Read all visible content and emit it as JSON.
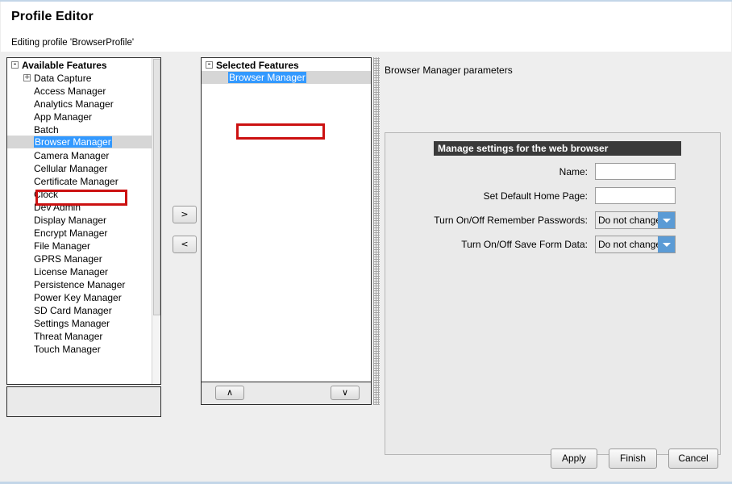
{
  "window": {
    "title": "Profile Editor",
    "subtitle": "Editing profile 'BrowserProfile'",
    "accent_blue": "#3399ff",
    "annotation_color": "#cc1111",
    "combo_button_color": "#5b9bd5",
    "banner_color": "#3a3a3a"
  },
  "available": {
    "root_label": "Available Features",
    "root_expander": "-",
    "group": {
      "label": "Data Capture",
      "expander": "+"
    },
    "items": [
      "Access Manager",
      "Analytics Manager",
      "App Manager",
      "Batch",
      "Browser Manager",
      "Camera Manager",
      "Cellular Manager",
      "Certificate Manager",
      "Clock",
      "Dev Admin",
      "Display Manager",
      "Encrypt Manager",
      "File Manager",
      "GPRS Manager",
      "License Manager",
      "Persistence Manager",
      "Power Key Manager",
      "SD Card Manager",
      "Settings Manager",
      "Threat Manager",
      "Touch Manager"
    ],
    "selected_item": "Browser Manager",
    "description": ""
  },
  "transfer": {
    "add_label": ">",
    "remove_label": "<"
  },
  "selected": {
    "root_label": "Selected Features",
    "root_expander": "-",
    "items": [
      "Browser Manager"
    ],
    "selected_item": "Browser Manager",
    "move_up_label": "∧",
    "move_down_label": "∨"
  },
  "parameters": {
    "title": "Browser Manager parameters",
    "banner": "Manage settings for the web browser",
    "fields": [
      {
        "label": "Name:",
        "type": "text",
        "value": "",
        "placeholder": ""
      },
      {
        "label": "Set Default Home Page:",
        "type": "text",
        "value": "",
        "placeholder": ""
      },
      {
        "label": "Turn On/Off Remember Passwords:",
        "type": "combo",
        "value": "Do not change"
      },
      {
        "label": "Turn On/Off Save Form Data:",
        "type": "combo",
        "value": "Do not change"
      }
    ]
  },
  "footer": {
    "apply": "Apply",
    "finish": "Finish",
    "cancel": "Cancel"
  }
}
